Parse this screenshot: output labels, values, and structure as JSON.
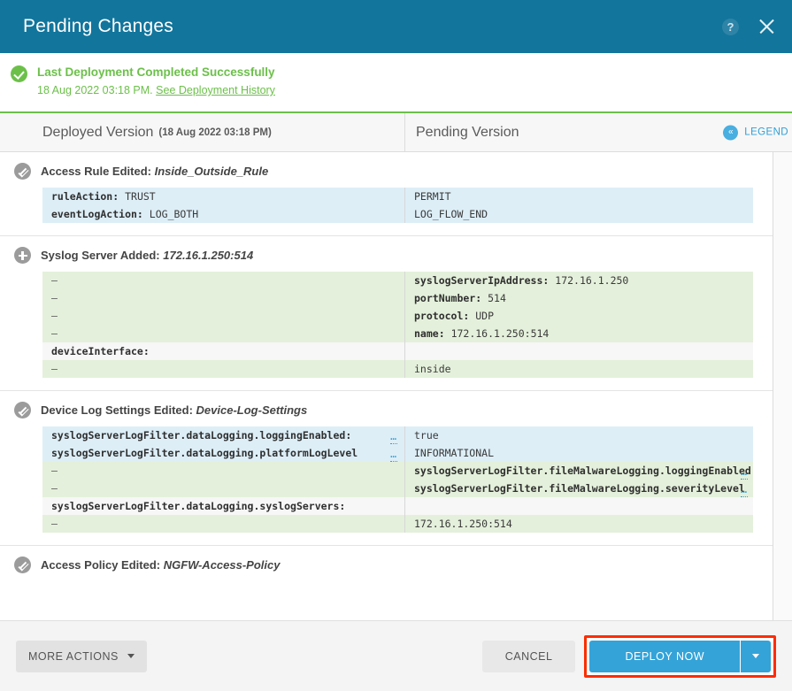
{
  "titlebar": {
    "title": "Pending Changes",
    "help_icon": "help-circle-icon",
    "close_icon": "close-icon"
  },
  "banner": {
    "status_icon": "check-circle-icon",
    "title": "Last Deployment Completed Successfully",
    "timestamp": "18 Aug 2022 03:18 PM.",
    "history_link": "See Deployment History"
  },
  "columns": {
    "deployed_label": "Deployed Version",
    "deployed_stamp": "(18 Aug 2022 03:18 PM)",
    "pending_label": "Pending Version",
    "legend_label": "LEGEND",
    "legend_icon": "chevron-double-left-icon"
  },
  "sections": [
    {
      "icon": "pencil-icon",
      "type": "edited",
      "title": "Access Rule Edited:",
      "name": "Inside_Outside_Rule",
      "rows": [
        {
          "state": "changed",
          "left_key": "ruleAction:",
          "left_val": "TRUST",
          "left_ellipsis": "",
          "right_key": "",
          "right_val": "PERMIT",
          "right_ellipsis": ""
        },
        {
          "state": "changed",
          "left_key": "eventLogAction:",
          "left_val": "LOG_BOTH",
          "left_ellipsis": "",
          "right_key": "",
          "right_val": "LOG_FLOW_END",
          "right_ellipsis": ""
        }
      ]
    },
    {
      "icon": "plus-icon",
      "type": "added",
      "title": "Syslog Server Added:",
      "name": "172.16.1.250:514",
      "rows": [
        {
          "state": "added",
          "left_key": "",
          "left_val": "–",
          "left_ellipsis": "",
          "right_key": "syslogServerIpAddress:",
          "right_val": "172.16.1.250",
          "right_ellipsis": ""
        },
        {
          "state": "added",
          "left_key": "",
          "left_val": "–",
          "left_ellipsis": "",
          "right_key": "portNumber:",
          "right_val": "514",
          "right_ellipsis": ""
        },
        {
          "state": "added",
          "left_key": "",
          "left_val": "–",
          "left_ellipsis": "",
          "right_key": "protocol:",
          "right_val": "UDP",
          "right_ellipsis": ""
        },
        {
          "state": "added",
          "left_key": "",
          "left_val": "–",
          "left_ellipsis": "",
          "right_key": "name:",
          "right_val": "172.16.1.250:514",
          "right_ellipsis": ""
        },
        {
          "state": "neutral",
          "left_key": "deviceInterface:",
          "left_val": "",
          "left_ellipsis": "",
          "right_key": "",
          "right_val": "",
          "right_ellipsis": ""
        },
        {
          "state": "added",
          "left_key": "",
          "left_val": "–",
          "left_ellipsis": "",
          "right_key": "",
          "right_val": "inside",
          "right_ellipsis": ""
        }
      ]
    },
    {
      "icon": "pencil-icon",
      "type": "edited",
      "title": "Device Log Settings Edited:",
      "name": "Device-Log-Settings",
      "rows": [
        {
          "state": "changed",
          "left_key": "syslogServerLogFilter.dataLogging.loggingEnabled:",
          "left_val": "",
          "left_ellipsis": "…",
          "right_key": "",
          "right_val": "true",
          "right_ellipsis": ""
        },
        {
          "state": "changed",
          "left_key": "syslogServerLogFilter.dataLogging.platformLogLevel",
          "left_val": "",
          "left_ellipsis": "…",
          "right_key": "",
          "right_val": "INFORMATIONAL",
          "right_ellipsis": ""
        },
        {
          "state": "added",
          "left_key": "",
          "left_val": "–",
          "left_ellipsis": "",
          "right_key": "syslogServerLogFilter.fileMalwareLogging.loggingEnabled:",
          "right_val": "",
          "right_ellipsis": "…"
        },
        {
          "state": "added",
          "left_key": "",
          "left_val": "–",
          "left_ellipsis": "",
          "right_key": "syslogServerLogFilter.fileMalwareLogging.severityLevel",
          "right_val": "",
          "right_ellipsis": "…"
        },
        {
          "state": "neutral",
          "left_key": "syslogServerLogFilter.dataLogging.syslogServers:",
          "left_val": "",
          "left_ellipsis": "",
          "right_key": "",
          "right_val": "",
          "right_ellipsis": ""
        },
        {
          "state": "added",
          "left_key": "",
          "left_val": "–",
          "left_ellipsis": "",
          "right_key": "",
          "right_val": "172.16.1.250:514",
          "right_ellipsis": ""
        }
      ]
    },
    {
      "icon": "pencil-icon",
      "type": "edited",
      "title": "Access Policy Edited:",
      "name": "NGFW-Access-Policy",
      "rows": []
    }
  ],
  "footer": {
    "more_actions_label": "MORE ACTIONS",
    "cancel_label": "CANCEL",
    "deploy_label": "DEPLOY NOW",
    "deploy_caret_icon": "chevron-down-icon"
  },
  "colors": {
    "header_blue": "#12759c",
    "success_green": "#6cc04a",
    "link_blue": "#2f9fd6",
    "deploy_blue": "#34a3d8",
    "highlight_red": "#fc2d00",
    "diff_changed": "#ddeef7",
    "diff_added": "#e4f0db"
  }
}
